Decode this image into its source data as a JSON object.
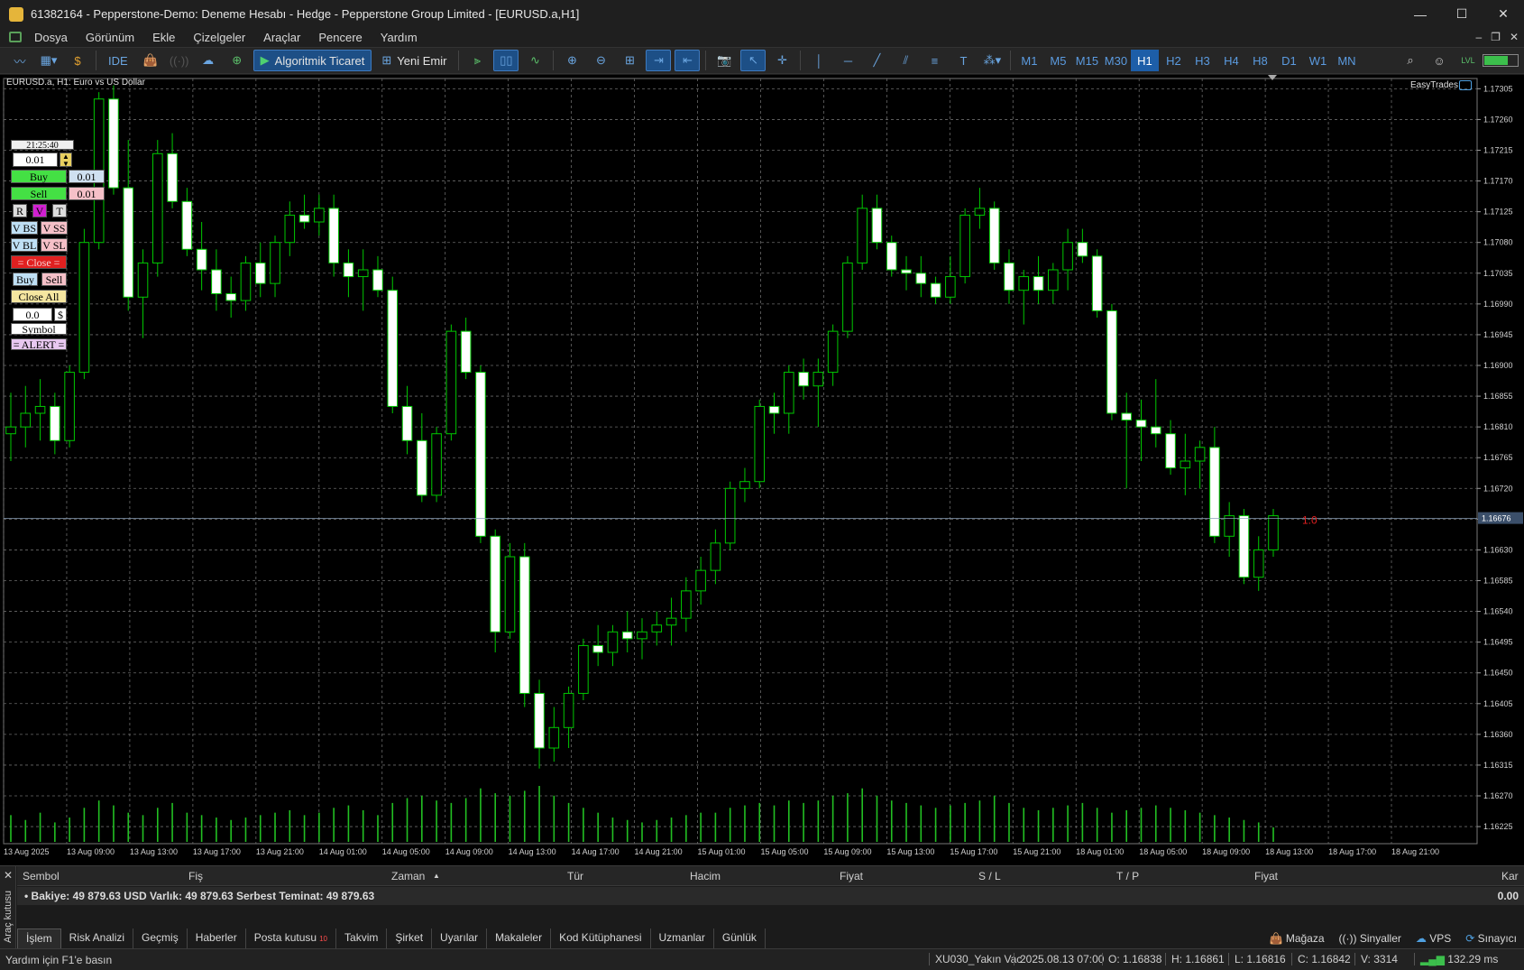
{
  "window": {
    "title": "61382164 - Pepperstone-Demo: Deneme Hesabı - Hedge - Pepperstone Group Limited - [EURUSD.a,H1]",
    "controls": [
      "—",
      "☐",
      "✕"
    ]
  },
  "menu": {
    "items": [
      "Dosya",
      "Görünüm",
      "Ekle",
      "Çizelgeler",
      "Araçlar",
      "Pencere",
      "Yardım"
    ],
    "mdi_controls": [
      "–",
      "❐",
      "✕"
    ]
  },
  "toolbar": {
    "ide_label": "IDE",
    "algo_label": "Algoritmik Ticaret",
    "new_order_label": "Yeni Emir",
    "timeframes": [
      "M1",
      "M5",
      "M15",
      "M30",
      "H1",
      "H2",
      "H3",
      "H4",
      "H8",
      "D1",
      "W1",
      "MN"
    ],
    "active_timeframe": "H1"
  },
  "chart": {
    "symbol_label": "EURUSD.a, H1:  Euro vs US Dollar",
    "ea_label": "EasyTrades",
    "current_price_label": "1.16676",
    "line_label": "1.0",
    "price_ticks": [
      "1.17305",
      "1.17260",
      "1.17215",
      "1.17170",
      "1.17125",
      "1.17080",
      "1.17035",
      "1.16990",
      "1.16945",
      "1.16900",
      "1.16855",
      "1.16810",
      "1.16765",
      "1.16720",
      "1.16675",
      "1.16630",
      "1.16585",
      "1.16540",
      "1.16495",
      "1.16450",
      "1.16405",
      "1.16360",
      "1.16315",
      "1.16270",
      "1.16225"
    ],
    "time_ticks": [
      "13 Aug 2025",
      "13 Aug 09:00",
      "13 Aug 13:00",
      "13 Aug 17:00",
      "13 Aug 21:00",
      "14 Aug 01:00",
      "14 Aug 05:00",
      "14 Aug 09:00",
      "14 Aug 13:00",
      "14 Aug 17:00",
      "14 Aug 21:00",
      "15 Aug 01:00",
      "15 Aug 05:00",
      "15 Aug 09:00",
      "15 Aug 13:00",
      "15 Aug 17:00",
      "15 Aug 21:00",
      "18 Aug 01:00",
      "18 Aug 05:00",
      "18 Aug 09:00",
      "18 Aug 13:00",
      "18 Aug 17:00",
      "18 Aug 21:00"
    ],
    "colors": {
      "bull": "#00c800",
      "bear": "#ffffff",
      "grid": "#6a6a6a",
      "volume": "#22c022",
      "price_line": "#8aa0b8"
    }
  },
  "chart_data": {
    "type": "candlestick",
    "symbol": "EURUSD.a",
    "timeframe": "H1",
    "price_range": [
      1.162,
      1.1732
    ],
    "series": [
      {
        "o": 1.168,
        "h": 1.1686,
        "l": 1.1676,
        "c": 1.1681
      },
      {
        "o": 1.1681,
        "h": 1.1687,
        "l": 1.1678,
        "c": 1.1683
      },
      {
        "o": 1.1683,
        "h": 1.1688,
        "l": 1.1679,
        "c": 1.1684
      },
      {
        "o": 1.1684,
        "h": 1.1686,
        "l": 1.1677,
        "c": 1.1679
      },
      {
        "o": 1.1679,
        "h": 1.169,
        "l": 1.1678,
        "c": 1.1689
      },
      {
        "o": 1.1689,
        "h": 1.171,
        "l": 1.1688,
        "c": 1.1708
      },
      {
        "o": 1.1708,
        "h": 1.173,
        "l": 1.1707,
        "c": 1.1729
      },
      {
        "o": 1.1729,
        "h": 1.1731,
        "l": 1.1715,
        "c": 1.1716
      },
      {
        "o": 1.1716,
        "h": 1.1723,
        "l": 1.1698,
        "c": 1.17
      },
      {
        "o": 1.17,
        "h": 1.1707,
        "l": 1.1694,
        "c": 1.1705
      },
      {
        "o": 1.1705,
        "h": 1.1723,
        "l": 1.1703,
        "c": 1.1721
      },
      {
        "o": 1.1721,
        "h": 1.1724,
        "l": 1.1713,
        "c": 1.1714
      },
      {
        "o": 1.1714,
        "h": 1.1716,
        "l": 1.1706,
        "c": 1.1707
      },
      {
        "o": 1.1707,
        "h": 1.1711,
        "l": 1.1701,
        "c": 1.1704
      },
      {
        "o": 1.1704,
        "h": 1.1707,
        "l": 1.1698,
        "c": 1.17005
      },
      {
        "o": 1.17005,
        "h": 1.1703,
        "l": 1.1697,
        "c": 1.16995
      },
      {
        "o": 1.16995,
        "h": 1.1706,
        "l": 1.1698,
        "c": 1.1705
      },
      {
        "o": 1.1705,
        "h": 1.1708,
        "l": 1.17,
        "c": 1.1702
      },
      {
        "o": 1.1702,
        "h": 1.1709,
        "l": 1.17,
        "c": 1.1708
      },
      {
        "o": 1.1708,
        "h": 1.1714,
        "l": 1.1706,
        "c": 1.1712
      },
      {
        "o": 1.1712,
        "h": 1.1715,
        "l": 1.171,
        "c": 1.1711
      },
      {
        "o": 1.1711,
        "h": 1.1715,
        "l": 1.1709,
        "c": 1.1713
      },
      {
        "o": 1.1713,
        "h": 1.1715,
        "l": 1.1703,
        "c": 1.1705
      },
      {
        "o": 1.1705,
        "h": 1.1707,
        "l": 1.17,
        "c": 1.1703
      },
      {
        "o": 1.1703,
        "h": 1.1707,
        "l": 1.1698,
        "c": 1.1704
      },
      {
        "o": 1.1704,
        "h": 1.1706,
        "l": 1.17,
        "c": 1.1701
      },
      {
        "o": 1.1701,
        "h": 1.1703,
        "l": 1.1683,
        "c": 1.1684
      },
      {
        "o": 1.1684,
        "h": 1.1687,
        "l": 1.1677,
        "c": 1.1679
      },
      {
        "o": 1.1679,
        "h": 1.1683,
        "l": 1.167,
        "c": 1.1671
      },
      {
        "o": 1.1671,
        "h": 1.1681,
        "l": 1.167,
        "c": 1.168
      },
      {
        "o": 1.168,
        "h": 1.1696,
        "l": 1.1679,
        "c": 1.1695
      },
      {
        "o": 1.1695,
        "h": 1.1697,
        "l": 1.1688,
        "c": 1.1689
      },
      {
        "o": 1.1689,
        "h": 1.169,
        "l": 1.1664,
        "c": 1.1665
      },
      {
        "o": 1.1665,
        "h": 1.1666,
        "l": 1.1648,
        "c": 1.1651
      },
      {
        "o": 1.1651,
        "h": 1.1664,
        "l": 1.165,
        "c": 1.1662
      },
      {
        "o": 1.1662,
        "h": 1.1664,
        "l": 1.164,
        "c": 1.1642
      },
      {
        "o": 1.1642,
        "h": 1.1644,
        "l": 1.1631,
        "c": 1.1634
      },
      {
        "o": 1.1634,
        "h": 1.164,
        "l": 1.1632,
        "c": 1.1637
      },
      {
        "o": 1.1637,
        "h": 1.1643,
        "l": 1.1634,
        "c": 1.1642
      },
      {
        "o": 1.1642,
        "h": 1.165,
        "l": 1.1641,
        "c": 1.1649
      },
      {
        "o": 1.1649,
        "h": 1.1652,
        "l": 1.1646,
        "c": 1.1648
      },
      {
        "o": 1.1648,
        "h": 1.1652,
        "l": 1.1646,
        "c": 1.1651
      },
      {
        "o": 1.1651,
        "h": 1.1654,
        "l": 1.1648,
        "c": 1.165
      },
      {
        "o": 1.165,
        "h": 1.1653,
        "l": 1.1647,
        "c": 1.1651
      },
      {
        "o": 1.1651,
        "h": 1.1654,
        "l": 1.1649,
        "c": 1.1652
      },
      {
        "o": 1.1652,
        "h": 1.1656,
        "l": 1.1649,
        "c": 1.1653
      },
      {
        "o": 1.1653,
        "h": 1.1659,
        "l": 1.1651,
        "c": 1.1657
      },
      {
        "o": 1.1657,
        "h": 1.1662,
        "l": 1.1655,
        "c": 1.166
      },
      {
        "o": 1.166,
        "h": 1.1666,
        "l": 1.1658,
        "c": 1.1664
      },
      {
        "o": 1.1664,
        "h": 1.1673,
        "l": 1.1663,
        "c": 1.1672
      },
      {
        "o": 1.1672,
        "h": 1.1675,
        "l": 1.167,
        "c": 1.1673
      },
      {
        "o": 1.1673,
        "h": 1.1685,
        "l": 1.1672,
        "c": 1.1684
      },
      {
        "o": 1.1684,
        "h": 1.1686,
        "l": 1.168,
        "c": 1.1683
      },
      {
        "o": 1.1683,
        "h": 1.169,
        "l": 1.168,
        "c": 1.1689
      },
      {
        "o": 1.1689,
        "h": 1.1691,
        "l": 1.1685,
        "c": 1.1687
      },
      {
        "o": 1.1687,
        "h": 1.1691,
        "l": 1.1681,
        "c": 1.1689
      },
      {
        "o": 1.1689,
        "h": 1.1696,
        "l": 1.1687,
        "c": 1.1695
      },
      {
        "o": 1.1695,
        "h": 1.1706,
        "l": 1.1694,
        "c": 1.1705
      },
      {
        "o": 1.1705,
        "h": 1.1715,
        "l": 1.1704,
        "c": 1.1713
      },
      {
        "o": 1.1713,
        "h": 1.1715,
        "l": 1.1707,
        "c": 1.1708
      },
      {
        "o": 1.1708,
        "h": 1.1709,
        "l": 1.1703,
        "c": 1.1704
      },
      {
        "o": 1.1704,
        "h": 1.1706,
        "l": 1.1701,
        "c": 1.17035
      },
      {
        "o": 1.17035,
        "h": 1.1706,
        "l": 1.17,
        "c": 1.1702
      },
      {
        "o": 1.1702,
        "h": 1.1703,
        "l": 1.1699,
        "c": 1.17
      },
      {
        "o": 1.17,
        "h": 1.1706,
        "l": 1.1699,
        "c": 1.1703
      },
      {
        "o": 1.1703,
        "h": 1.1713,
        "l": 1.1702,
        "c": 1.1712
      },
      {
        "o": 1.1712,
        "h": 1.1716,
        "l": 1.171,
        "c": 1.1713
      },
      {
        "o": 1.1713,
        "h": 1.1714,
        "l": 1.1704,
        "c": 1.1705
      },
      {
        "o": 1.1705,
        "h": 1.1707,
        "l": 1.1699,
        "c": 1.1701
      },
      {
        "o": 1.1701,
        "h": 1.1704,
        "l": 1.1696,
        "c": 1.1703
      },
      {
        "o": 1.1703,
        "h": 1.1706,
        "l": 1.1699,
        "c": 1.1701
      },
      {
        "o": 1.1701,
        "h": 1.1705,
        "l": 1.1699,
        "c": 1.1704
      },
      {
        "o": 1.1704,
        "h": 1.171,
        "l": 1.1701,
        "c": 1.1708
      },
      {
        "o": 1.1708,
        "h": 1.171,
        "l": 1.1705,
        "c": 1.1706
      },
      {
        "o": 1.1706,
        "h": 1.1707,
        "l": 1.1697,
        "c": 1.1698
      },
      {
        "o": 1.1698,
        "h": 1.1699,
        "l": 1.1682,
        "c": 1.1683
      },
      {
        "o": 1.1683,
        "h": 1.1686,
        "l": 1.1672,
        "c": 1.1682
      },
      {
        "o": 1.1682,
        "h": 1.1685,
        "l": 1.1676,
        "c": 1.1681
      },
      {
        "o": 1.1681,
        "h": 1.1688,
        "l": 1.1678,
        "c": 1.168
      },
      {
        "o": 1.168,
        "h": 1.1682,
        "l": 1.1674,
        "c": 1.1675
      },
      {
        "o": 1.1675,
        "h": 1.168,
        "l": 1.1671,
        "c": 1.1676
      },
      {
        "o": 1.1676,
        "h": 1.1679,
        "l": 1.1672,
        "c": 1.1678
      },
      {
        "o": 1.1678,
        "h": 1.1681,
        "l": 1.1664,
        "c": 1.1665
      },
      {
        "o": 1.1665,
        "h": 1.167,
        "l": 1.1662,
        "c": 1.1668
      },
      {
        "o": 1.1668,
        "h": 1.1669,
        "l": 1.1658,
        "c": 1.1659
      },
      {
        "o": 1.1659,
        "h": 1.1665,
        "l": 1.1657,
        "c": 1.1663
      },
      {
        "o": 1.1663,
        "h": 1.1669,
        "l": 1.1662,
        "c": 1.1668
      }
    ],
    "volume": [
      55,
      45,
      60,
      40,
      50,
      70,
      85,
      75,
      60,
      55,
      70,
      80,
      60,
      55,
      50,
      45,
      50,
      55,
      60,
      65,
      55,
      60,
      70,
      75,
      65,
      55,
      80,
      90,
      95,
      85,
      80,
      90,
      110,
      100,
      95,
      105,
      115,
      95,
      80,
      70,
      60,
      50,
      45,
      40,
      45,
      50,
      55,
      60,
      60,
      70,
      75,
      80,
      75,
      85,
      80,
      85,
      95,
      100,
      110,
      95,
      85,
      80,
      75,
      70,
      75,
      80,
      85,
      95,
      80,
      70,
      65,
      70,
      75,
      80,
      70,
      60,
      65,
      70,
      75,
      70,
      65,
      60,
      55,
      50,
      45,
      40,
      30
    ]
  },
  "panel": {
    "time": "21:25:40",
    "lot": "0.01",
    "buy_label": "Buy",
    "buy_value": "0.01",
    "sell_label": "Sell",
    "sell_value": "0.01",
    "r": "R",
    "v": "V",
    "t": "T",
    "vbs": "V BS",
    "vss": "V SS",
    "vbl": "V BL",
    "vsl": "V SL",
    "close": "= Close =",
    "buy2": "Buy",
    "sell2": "Sell",
    "close_all": "Close All",
    "amount": "0.0",
    "dollar": "$",
    "symbol": "Symbol",
    "alert": "= ALERT ="
  },
  "terminal": {
    "side_label": "Araç kutusu",
    "columns": [
      "Sembol",
      "Fiş",
      "Zaman",
      "Tür",
      "Hacim",
      "Fiyat",
      "S / L",
      "T / P",
      "Fiyat",
      "Kar"
    ],
    "balance_line": "Bakiye: 49 879.63 USD  Varlık: 49 879.63  Serbest Teminat: 49 879.63",
    "balance_value": "0.00",
    "tabs": [
      "İşlem",
      "Risk Analizi",
      "Geçmiş",
      "Haberler",
      "Posta kutusu",
      "Takvim",
      "Şirket",
      "Uyarılar",
      "Makaleler",
      "Kod Kütüphanesi",
      "Uzmanlar",
      "Günlük"
    ],
    "mail_badge": "10",
    "right_tabs": [
      "Mağaza",
      "Sinyaller",
      "VPS",
      "Sınayıcı"
    ]
  },
  "status": {
    "help": "Yardım için F1'e basın",
    "symbol_time": "XU030_Yakın Vac",
    "datetime": "2025.08.13 07:00",
    "open": "O: 1.16838",
    "high": "H: 1.16861",
    "low": "L: 1.16816",
    "close": "C: 1.16842",
    "volume": "V: 3314",
    "ping": "132.29 ms"
  }
}
